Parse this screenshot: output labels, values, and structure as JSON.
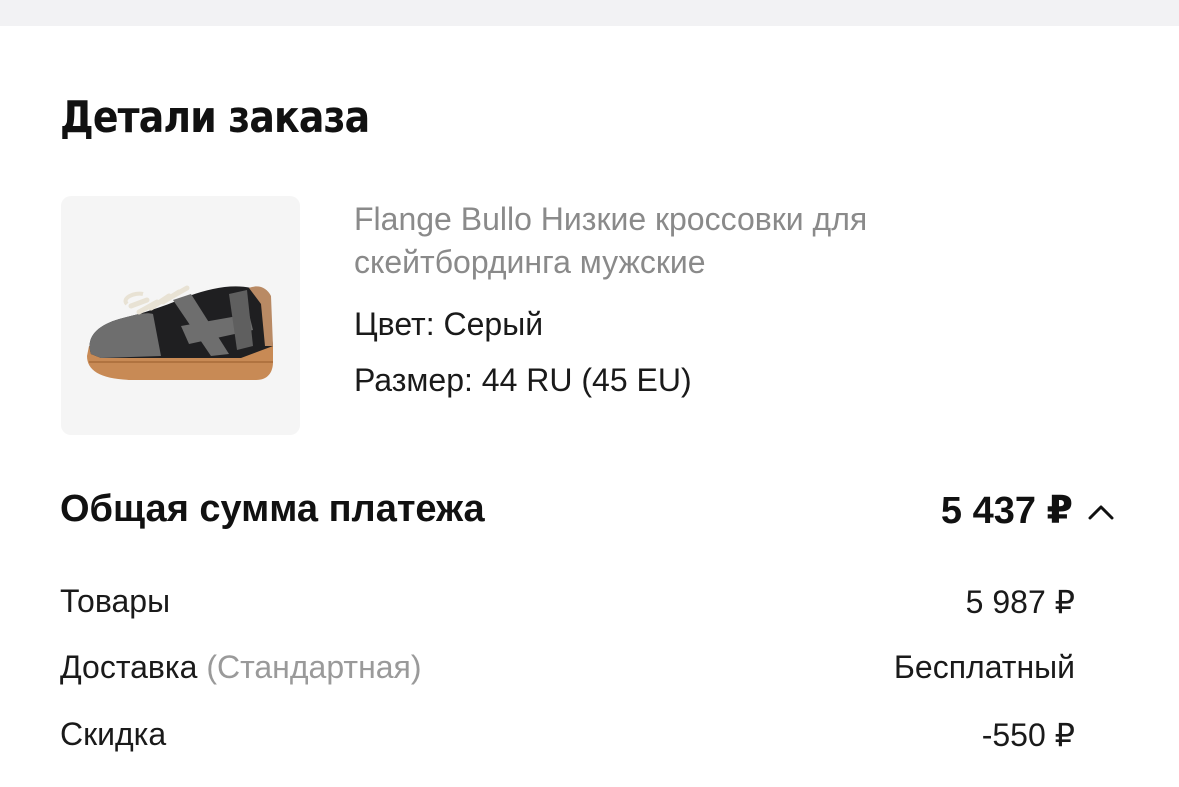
{
  "order_details": {
    "title": "Детали заказа"
  },
  "product": {
    "image_icon": "sneaker-image",
    "title": "Flange Bullo Низкие кроссовки для скейтбординга мужские",
    "color": "Цвет: Серый",
    "size": "Размер: 44 RU (45 EU)"
  },
  "payment": {
    "total_label": "Общая сумма платежа",
    "total_value": "5 437 ₽",
    "toggle_icon": "chevron-up-icon",
    "rows": [
      {
        "label": "Товары",
        "note": "",
        "value": "5 987 ₽"
      },
      {
        "label": "Доставка",
        "note": "(Стандартная)",
        "value": "Бесплатный"
      },
      {
        "label": "Скидка",
        "note": "",
        "value": "-550 ₽"
      }
    ]
  },
  "colors": {
    "background": "#ffffff",
    "top_strip": "#f2f2f4",
    "muted_text": "#8a8a8a",
    "text": "#1a1a1a"
  }
}
